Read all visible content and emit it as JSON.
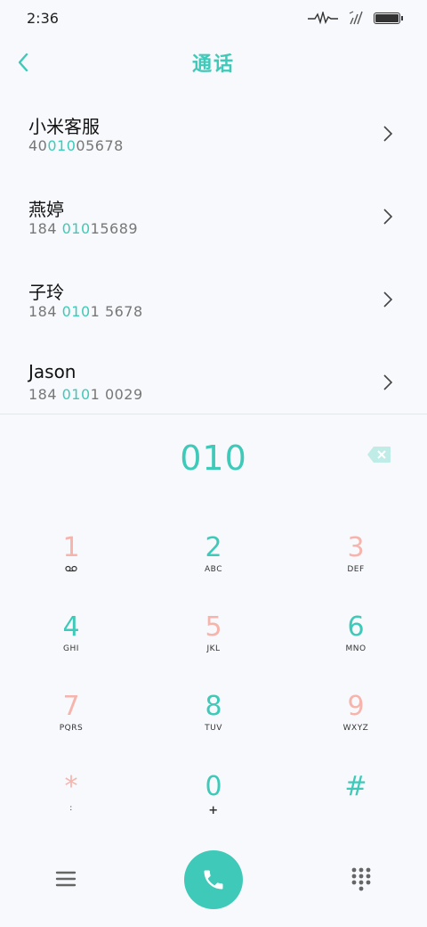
{
  "status": {
    "time": "2:36"
  },
  "header": {
    "title": "通话"
  },
  "contacts": [
    {
      "name": "小米客服",
      "num_pre": "40",
      "num_hl": "010",
      "num_post": "05678"
    },
    {
      "name": "燕婷",
      "num_pre": "184 ",
      "num_hl": "010",
      "num_post": "15689"
    },
    {
      "name": "子玲",
      "num_pre": "184 ",
      "num_hl": "010",
      "num_post": "1 5678"
    },
    {
      "name": "Jason",
      "num_pre": "184 ",
      "num_hl": "010",
      "num_post": "1 0029"
    }
  ],
  "dialer": {
    "input": "010"
  },
  "keypad": [
    {
      "digit": "1",
      "sub": "voicemail-icon",
      "color": "#f6b4ac"
    },
    {
      "digit": "2",
      "sub": "ABC",
      "color": "#3ec9b9"
    },
    {
      "digit": "3",
      "sub": "DEF",
      "color": "#f6b4ac"
    },
    {
      "digit": "4",
      "sub": "GHI",
      "color": "#3ec9b9"
    },
    {
      "digit": "5",
      "sub": "JKL",
      "color": "#f6b4ac"
    },
    {
      "digit": "6",
      "sub": "MNO",
      "color": "#3ec9b9"
    },
    {
      "digit": "7",
      "sub": "PQRS",
      "color": "#f6b4ac"
    },
    {
      "digit": "8",
      "sub": "TUV",
      "color": "#3ec9b9"
    },
    {
      "digit": "9",
      "sub": "WXYZ",
      "color": "#f6b4ac"
    },
    {
      "digit": "*",
      "sub": ":",
      "color": "#f6b4ac"
    },
    {
      "digit": "0",
      "sub": "+",
      "color": "#3ec9b9"
    },
    {
      "digit": "#",
      "sub": "",
      "color": "#3ec9b9"
    }
  ],
  "colors": {
    "accent": "#3ec9b9",
    "secondary": "#f6b4ac",
    "background": "#f7f9fc"
  }
}
